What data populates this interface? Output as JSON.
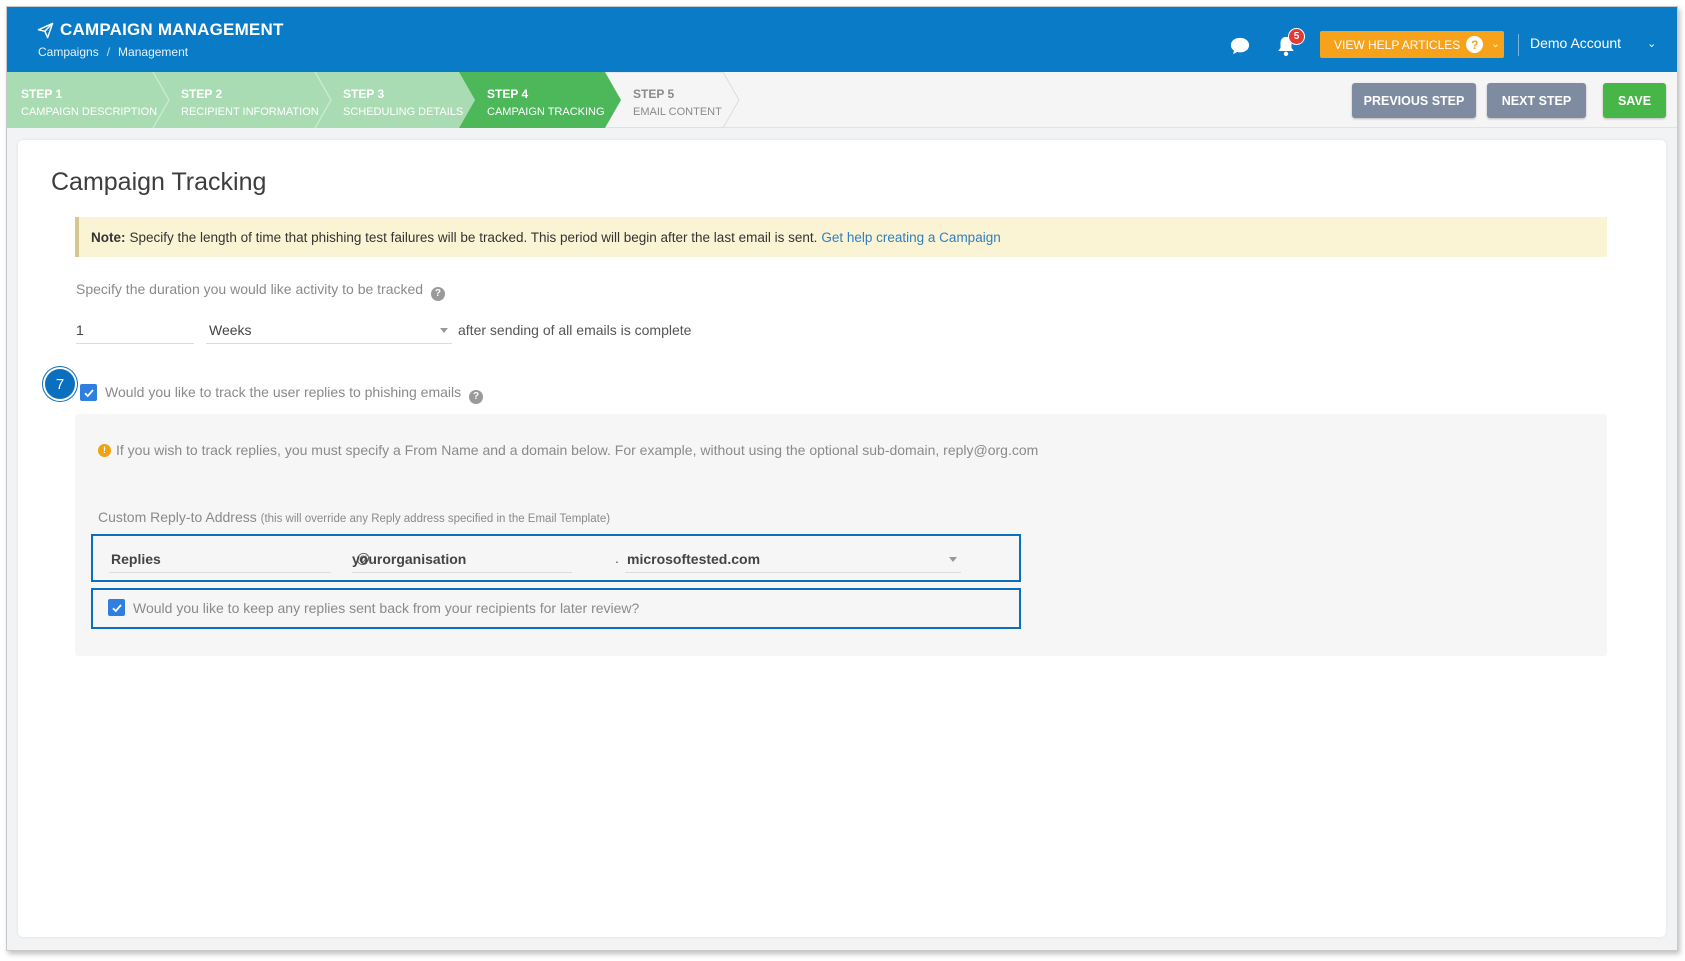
{
  "app": {
    "title": "CAMPAIGN MANAGEMENT",
    "breadcrumb": [
      "Campaigns",
      "/",
      "Management"
    ]
  },
  "header": {
    "notification_count": "5",
    "help_label": "VIEW HELP ARTICLES",
    "help_icon": "question-circle-icon",
    "account_name": "Demo Account"
  },
  "steps": [
    {
      "num": "STEP 1",
      "label": "CAMPAIGN DESCRIPTION",
      "state": "done"
    },
    {
      "num": "STEP 2",
      "label": "RECIPIENT INFORMATION",
      "state": "done"
    },
    {
      "num": "STEP 3",
      "label": "SCHEDULING DETAILS",
      "state": "done"
    },
    {
      "num": "STEP 4",
      "label": "CAMPAIGN TRACKING",
      "state": "active"
    },
    {
      "num": "STEP 5",
      "label": "EMAIL CONTENT",
      "state": "todo"
    }
  ],
  "actions": {
    "previous": "PREVIOUS STEP",
    "next": "NEXT STEP",
    "save": "SAVE"
  },
  "colors": {
    "header": "#0a7bc6",
    "step_done": "#a9dcb2",
    "step_active": "#4cb85a",
    "help_button": "#f7a21b",
    "save_button": "#46b649",
    "grey_button": "#7f8ba0",
    "highlight_box": "#0a6fbf"
  },
  "main": {
    "title": "Campaign Tracking",
    "note": {
      "prefix": "Note:",
      "text": "Specify the length of time that phishing test failures will be tracked. This period will begin after the last email is sent.",
      "link": "Get help creating a Campaign"
    },
    "duration": {
      "label": "Specify the duration you would like activity to be tracked",
      "value": "1",
      "unit": "Weeks",
      "suffix": "after sending of all emails is complete"
    },
    "callout_number": "7",
    "track_replies": {
      "checked": true,
      "label": "Would you like to track the user replies to phishing emails"
    },
    "reply_panel": {
      "info": "If you wish to track replies, you must specify a From Name and a domain below. For example, without using the optional sub-domain, reply@org.com",
      "address_label": "Custom Reply-to Address",
      "address_hint": "(this will override any Reply address specified in the Email Template)",
      "from_name": "Replies",
      "at": "@",
      "subdomain": "yourorganisation",
      "dot": ".",
      "domain": "microsoftested.com",
      "keep_replies": {
        "checked": true,
        "label": "Would you like to keep any replies sent back from your recipients for later review?"
      }
    }
  }
}
